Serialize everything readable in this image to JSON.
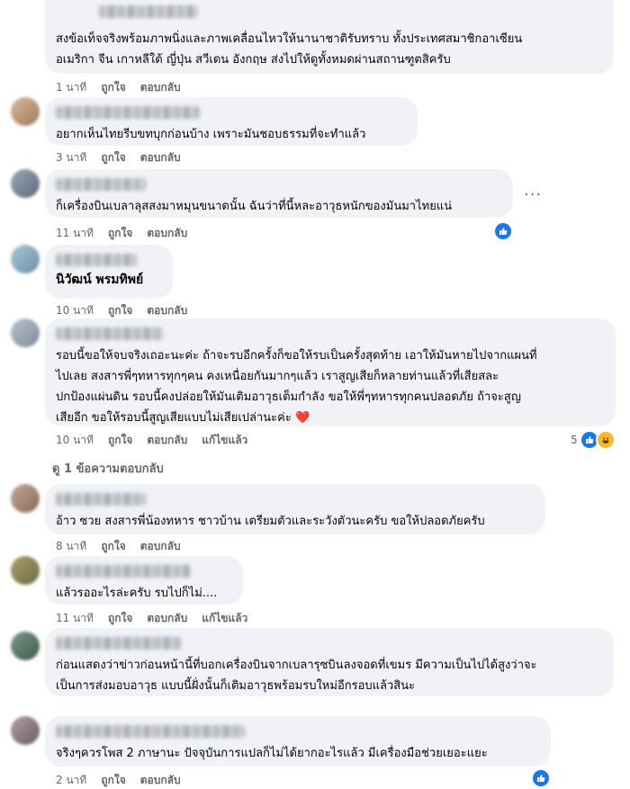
{
  "comments": [
    {
      "text": "สงข้อเท็จจริงพร้อมภาพนิ่งและภาพเคลื่อนไหวให้นานาชาติรับทราบ ทั้งประเทศสมาชิกอาเซียน\nอเมริกา จีน เกาหลีใต้ ญี่ปุ่น สวีเดน อังกฤษ ส่งไปให้ดูทั้งหมดผ่านสถานฑูตสิครับ",
      "time": "1 นาที",
      "like": "ถูกใจ",
      "reply": "ตอบกลับ"
    },
    {
      "text": "อยากเห็นไทยรีบขทบุกก่อนบ้าง เพราะมันชอบธรรมที่จะทำแล้ว",
      "time": "3 นาที",
      "like": "ถูกใจ",
      "reply": "ตอบกลับ"
    },
    {
      "text": "ก็เครื่องบินเบลาลุสสงมาหมุนขนาดนั้น ฉันว่าที่นี้หละอาวุธหนักของมันมาไทยแน่",
      "time": "11 นาที",
      "like": "ถูกใจ",
      "reply": "ตอบกลับ"
    },
    {
      "name": "นิวัฒน์ พรมทิพย์",
      "time": "10 นาที",
      "like": "ถูกใจ",
      "reply": "ตอบกลับ"
    },
    {
      "text": "รอบนี้ขอให้จบจริงเถอะนะค่ะ ถ้าจะรบอีกครั้งก็ขอให้รบเป็นครั้งสุดท้าย เอาให้มันหายไปจากแผนที่\nไปเลย สงสารพี่ๆทหารทุกๆคน คงเหนื่อยกันมากๆแล้ว เราสูญเสียก็หลายท่านแล้วที่เสียสละ\nปกป้องแผ่นดิน รอบนี้คงปล่อยให้มันเติมอาวุธเต็มกำลัง ขอให้พี่ๆทหารทุกคนปลอดภัย ถ้าจะสูญ\nเสียอีก ขอให้รอบนี้สูญเสียแบบไม่เสียเปล่านะค่ะ ❤️",
      "time": "10 นาที",
      "like": "ถูกใจ",
      "reply": "ตอบกลับ",
      "edited": "แก้ไขแล้ว",
      "reaction_count": "5"
    },
    {
      "text": "อ้าว ซวย สงสารพี่น้องทหาร ชาวบ้าน เตรียมตัวและระวังตัวนะครับ ขอให้ปลอดภัยครับ",
      "time": "8 นาที",
      "like": "ถูกใจ",
      "reply": "ตอบกลับ"
    },
    {
      "text": "แล้วรออะไรล่ะครับ รบไปก็ไม่....",
      "time": "11 นาที",
      "like": "ถูกใจ",
      "reply": "ตอบกลับ",
      "edited": "แก้ไขแล้ว"
    },
    {
      "text": "ก่อนแสดงว่าข่าวก่อนหน้านี้ที่บอกเครื่องบินจากเบลารุซบินลงจอดที่เขมร มีความเป็นไปได้สูงว่าจะ\nเป็นการส่งมอบอาวุธ แบบนี้ฝั่งนั้นก็เติมอาวุธพร้อมรบใหม่อีกรอบแล้วสินะ",
      "time": "",
      "like": "",
      "reply": ""
    },
    {
      "text": "จริงๆควรโพส 2 ภาษานะ ปัจจุบันการแปลก็ไม่ได้ยากอะไรแล้ว มีเครื่องมือช่วยเยอะแยะ",
      "time": "2 นาที",
      "like": "ถูกใจ",
      "reply": "ตอบกลับ"
    }
  ],
  "replies_link": "ดู 1 ข้อความตอบกลับ",
  "more_options": "···"
}
